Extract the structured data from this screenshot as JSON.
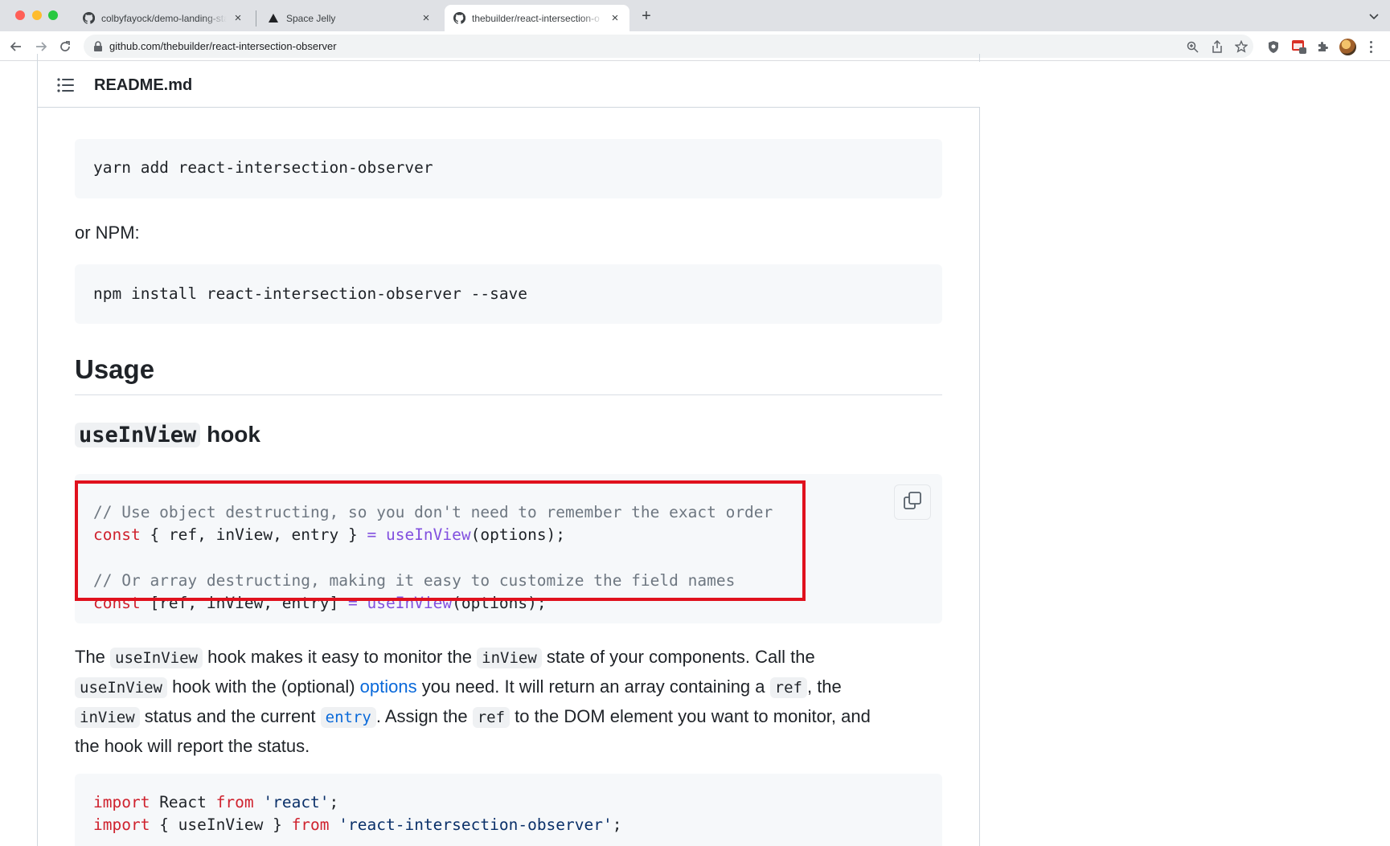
{
  "browser": {
    "tabs": [
      {
        "title": "colbyfayock/demo-landing-sta",
        "active": false
      },
      {
        "title": "Space Jelly",
        "active": false
      },
      {
        "title": "thebuilder/react-intersection-o",
        "active": true
      }
    ],
    "new_tab_label": "+",
    "url": "github.com/thebuilder/react-intersection-observer"
  },
  "readme": {
    "filename": "README.md",
    "yarn_cmd": "yarn add react-intersection-observer",
    "npm_label": "or NPM:",
    "npm_cmd": "npm install react-intersection-observer --save",
    "usage_heading": "Usage",
    "hook_heading_code": "useInView",
    "hook_heading_rest": " hook",
    "hook_code": {
      "l1": "// Use object destructing, so you don't need to remember the exact order",
      "l2": {
        "kw": "const",
        "a": " { ref, inView, entry } ",
        "op": "=",
        "sp": " ",
        "fn": "useInView",
        "b": "(options);"
      },
      "l4": "// Or array destructing, making it easy to customize the field names",
      "l5": {
        "kw": "const",
        "a": " [ref, inView, entry] ",
        "op": "=",
        "sp": " ",
        "fn": "useInView",
        "b": "(options);"
      }
    },
    "description": {
      "p1": "The ",
      "c1": "useInView",
      "p2": " hook makes it easy to monitor the ",
      "c2": "inView",
      "p3": " state of your components. Call the",
      "c3": "useInView",
      "p4": " hook with the (optional) ",
      "link_options": "options",
      "p5": " you need. It will return an array containing a ",
      "c4": "ref",
      "p6": ", the",
      "c5": "inView",
      "p7": " status and the current ",
      "link_entry": "entry",
      "p8": ". Assign the ",
      "c6": "ref",
      "p9": " to the DOM element you want to monitor, and",
      "p10": "the hook will report the status."
    },
    "import_code": {
      "l1": {
        "kw1": "import",
        "a": " React ",
        "kw2": "from",
        "sp": " ",
        "st": "'react'",
        "b": ";"
      },
      "l2": {
        "kw1": "import",
        "a": " { useInView } ",
        "kw2": "from",
        "sp": " ",
        "st": "'react-intersection-observer'",
        "b": ";"
      }
    }
  },
  "colors": {
    "highlight_border": "#e0111d",
    "keyword": "#cf222e",
    "function": "#8250df",
    "comment": "#6e7781",
    "link": "#0969da"
  }
}
